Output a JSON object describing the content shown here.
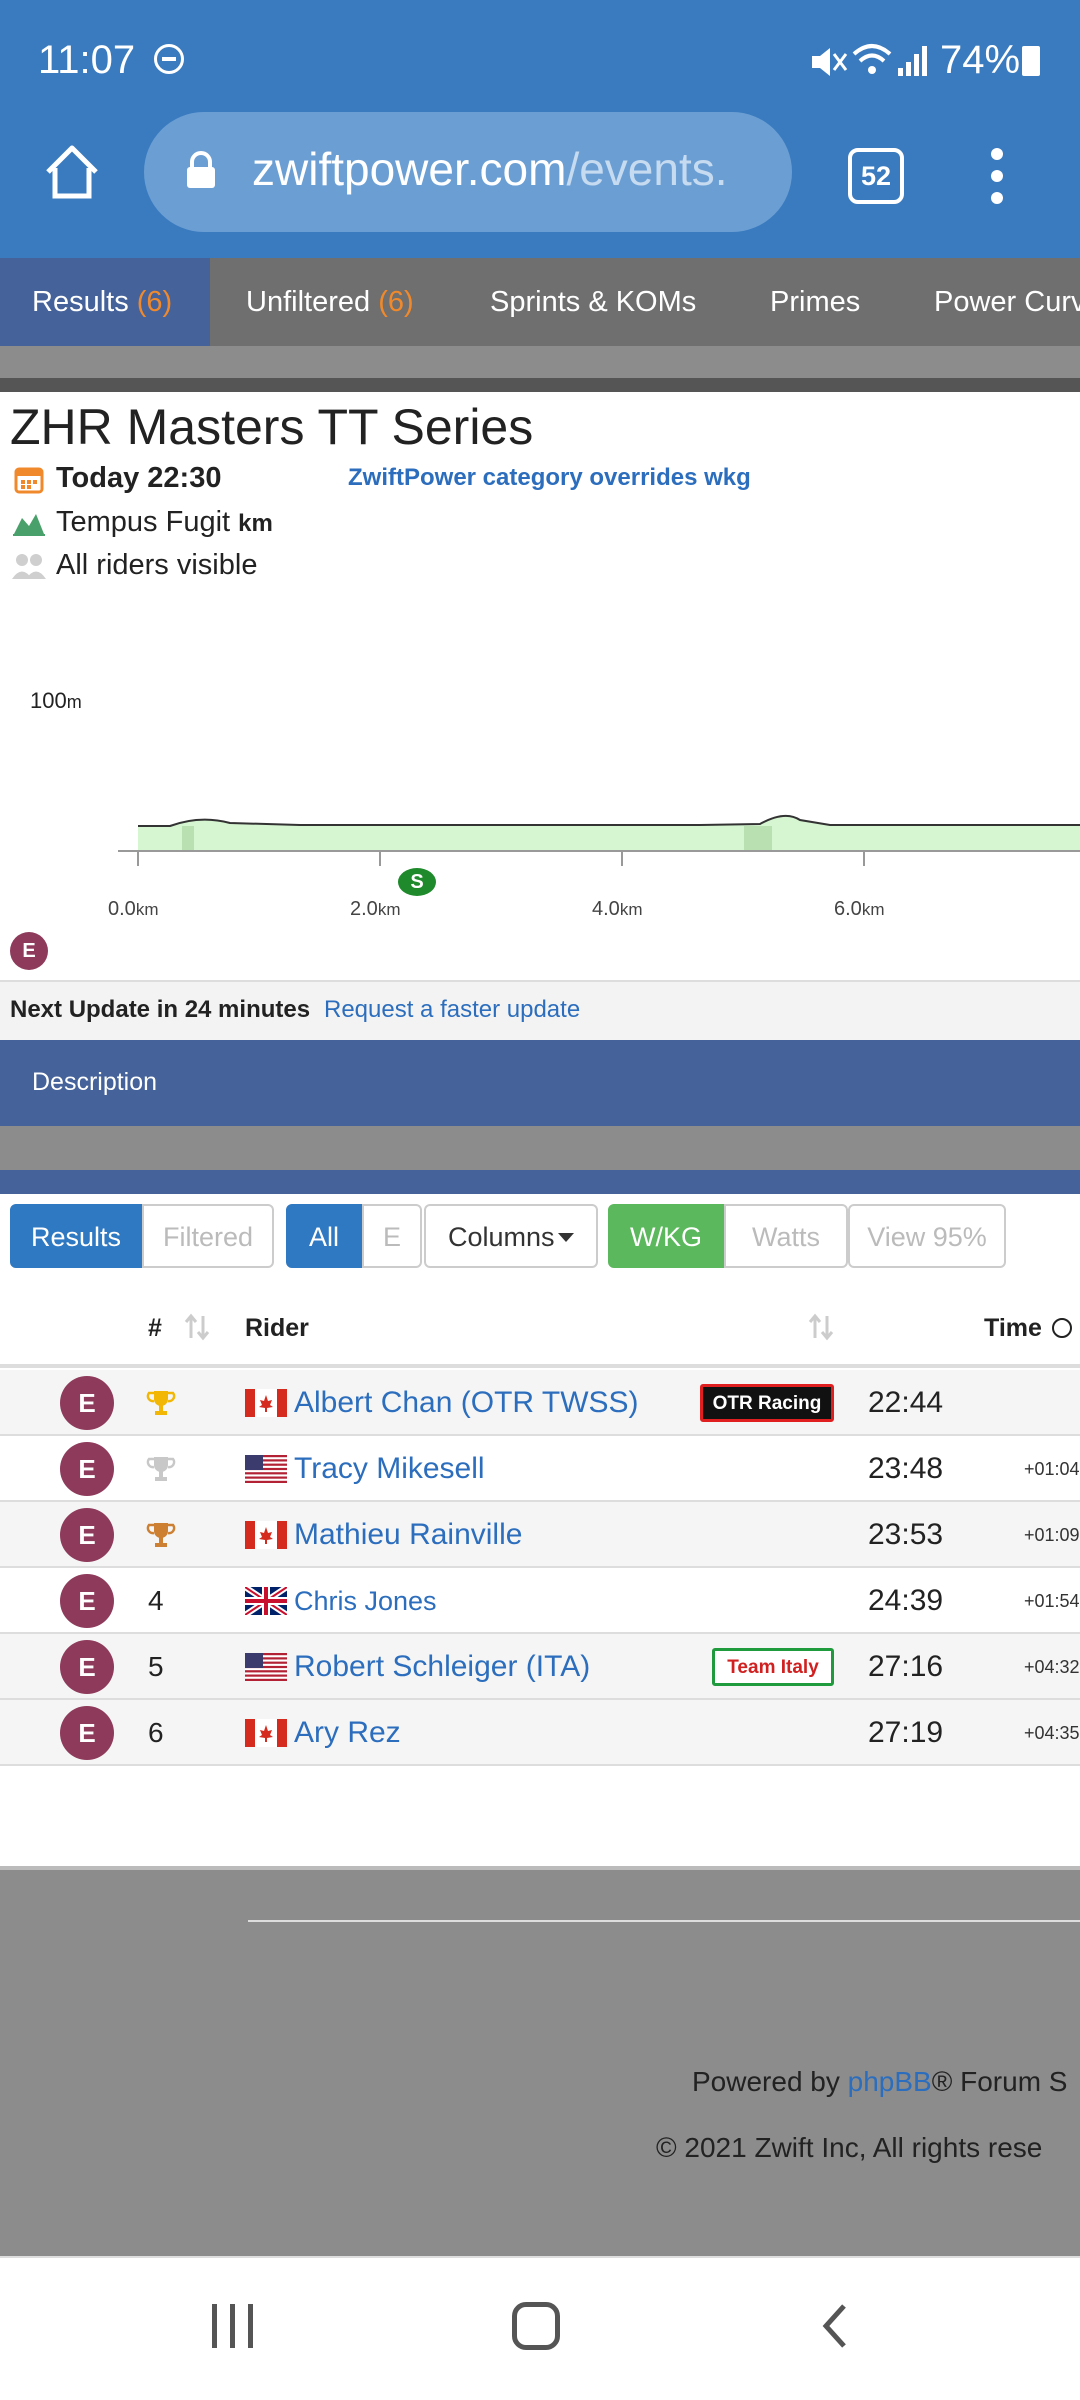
{
  "status": {
    "time": "11:07",
    "battery": "74%"
  },
  "browser": {
    "url_main": "zwiftpower.com",
    "url_path": "/events.",
    "tab_count": "52"
  },
  "tabs": [
    {
      "label": "Results",
      "count": "(6)"
    },
    {
      "label": "Unfiltered",
      "count": "(6)"
    },
    {
      "label": "Sprints & KOMs"
    },
    {
      "label": "Primes"
    },
    {
      "label": "Power Curv"
    }
  ],
  "event": {
    "title": "ZHR Masters TT Series",
    "date": "Today 22:30",
    "override": "ZwiftPower category overrides wkg",
    "route": "Tempus Fugit",
    "route_unit": "km",
    "visibility": "All riders visible"
  },
  "profile": {
    "y_label": "100",
    "y_unit": "m",
    "ticks": [
      {
        "value": "0.0",
        "unit": "km"
      },
      {
        "value": "2.0",
        "unit": "km"
      },
      {
        "value": "4.0",
        "unit": "km"
      },
      {
        "value": "6.0",
        "unit": "km"
      }
    ],
    "sprint_marker": "S",
    "category_badge": "E"
  },
  "update": {
    "bold": "Next Update in 24 minutes",
    "link": "Request a faster update"
  },
  "description_label": "Description",
  "filters": {
    "results": "Results",
    "filtered": "Filtered",
    "all": "All",
    "e": "E",
    "columns": "Columns",
    "wkg": "W/KG",
    "watts": "Watts",
    "view95": "View 95%"
  },
  "table": {
    "headers": {
      "rank": "#",
      "rider": "Rider",
      "time": "Time"
    },
    "rows": [
      {
        "cat": "E",
        "rank": "",
        "trophy": "gold",
        "flag": "ca",
        "name": "Albert Chan (OTR TWSS)",
        "team": "OTR Racing",
        "time": "22:44",
        "gap": ""
      },
      {
        "cat": "E",
        "rank": "",
        "trophy": "silver",
        "flag": "us",
        "name": "Tracy Mikesell",
        "team": "",
        "time": "23:48",
        "gap": "+01:04"
      },
      {
        "cat": "E",
        "rank": "",
        "trophy": "bronze",
        "flag": "ca",
        "name": "Mathieu Rainville",
        "team": "",
        "time": "23:53",
        "gap": "+01:09"
      },
      {
        "cat": "E",
        "rank": "4",
        "trophy": "",
        "flag": "gb",
        "name": "Chris Jones",
        "team": "",
        "time": "24:39",
        "gap": "+01:54"
      },
      {
        "cat": "E",
        "rank": "5",
        "trophy": "",
        "flag": "us",
        "name": "Robert Schleiger (ITA)",
        "team": "Team Italy",
        "time": "27:16",
        "gap": "+04:32"
      },
      {
        "cat": "E",
        "rank": "6",
        "trophy": "",
        "flag": "ca",
        "name": "Ary Rez",
        "team": "",
        "time": "27:19",
        "gap": "+04:35"
      }
    ]
  },
  "footer": {
    "powered_prefix": "Powered by ",
    "powered_link": "phpBB",
    "powered_suffix": "® Forum S",
    "copyright": "© 2021 Zwift Inc, All rights rese"
  }
}
